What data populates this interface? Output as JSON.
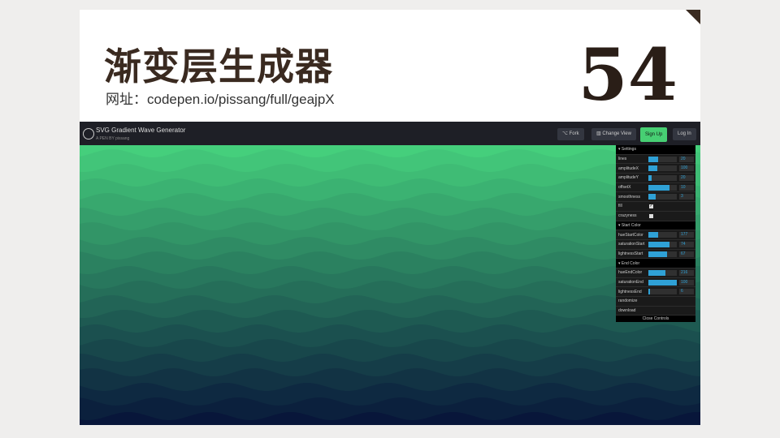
{
  "slide": {
    "title": "渐变层生成器",
    "url": "网址：codepen.io/pissang/full/geajpX",
    "number": "54"
  },
  "pen": {
    "title": "SVG Gradient Wave Generator",
    "by": "A PEN BY pissang",
    "fork": "⌥ Fork",
    "change_view": "▥ Change View",
    "signup": "Sign Up",
    "login": "Log In"
  },
  "colors": {
    "top": "#45cf7c",
    "bottom": "#08163a",
    "signup": "#47cf73"
  },
  "controls": {
    "settings": "▾ Settings",
    "sliders1": [
      {
        "label": "lines",
        "value": "20",
        "frac": 0.35
      },
      {
        "label": "amplitudeX",
        "value": "100",
        "frac": 0.3
      },
      {
        "label": "amplitudeY",
        "value": "20",
        "frac": 0.1
      },
      {
        "label": "offsetX",
        "value": "10",
        "frac": 0.75
      },
      {
        "label": "smoothness",
        "value": "3",
        "frac": 0.25
      }
    ],
    "fill": "fill",
    "crazyness": "crazyness",
    "start": "▾ Start Color",
    "sliders2": [
      {
        "label": "hueStartColor",
        "value": "177",
        "frac": 0.35
      },
      {
        "label": "saturationStart",
        "value": "74",
        "frac": 0.74
      },
      {
        "label": "lightnessStart",
        "value": "67",
        "frac": 0.67
      }
    ],
    "end": "▾ End Color",
    "sliders3": [
      {
        "label": "hueEndColor",
        "value": "216",
        "frac": 0.6
      },
      {
        "label": "saturationEnd",
        "value": "100",
        "frac": 1
      },
      {
        "label": "lightnessEnd",
        "value": "6",
        "frac": 0.06
      }
    ],
    "randomize": "randomize",
    "download": "download",
    "close": "Close Controls"
  }
}
